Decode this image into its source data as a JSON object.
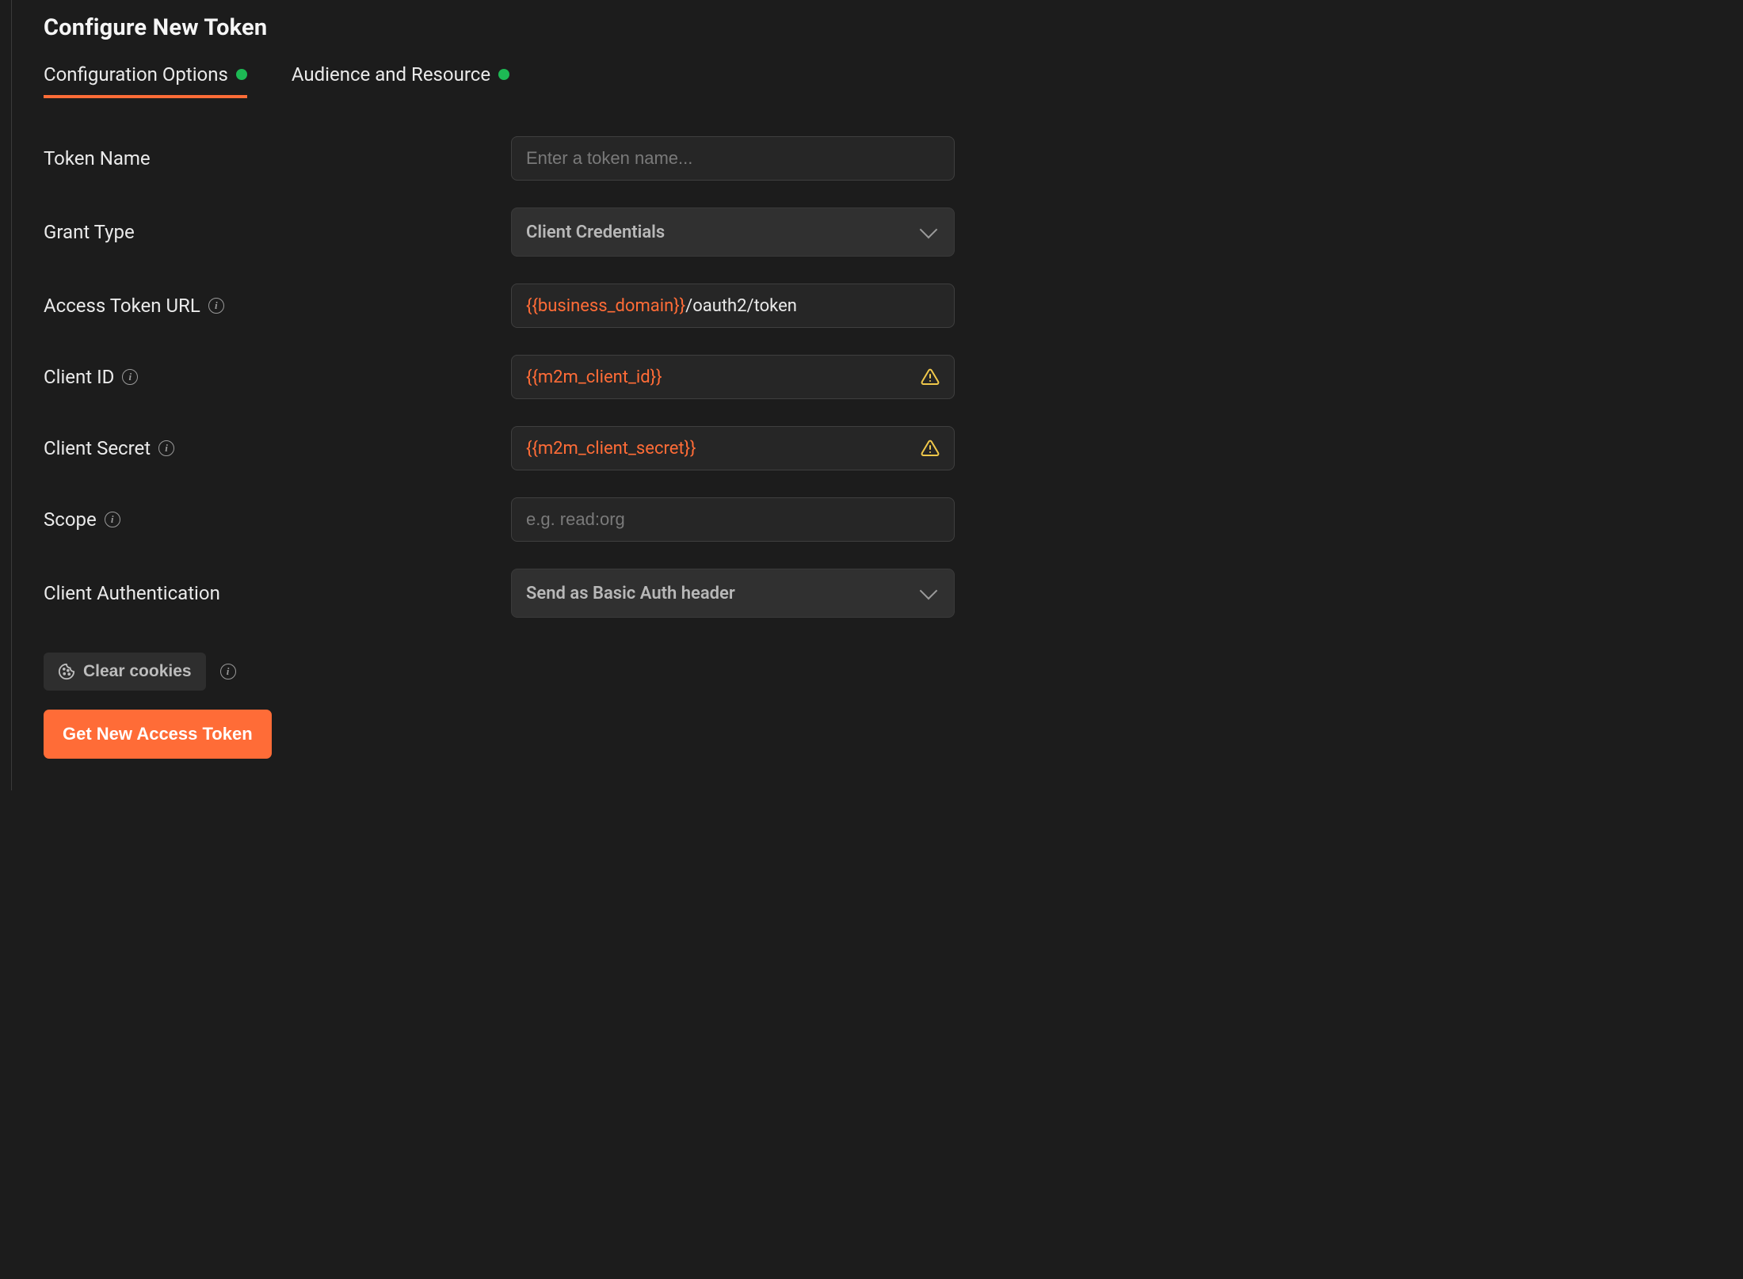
{
  "header": {
    "title": "Configure New Token"
  },
  "tabs": [
    {
      "label": "Configuration Options",
      "active": true
    },
    {
      "label": "Audience and Resource",
      "active": false
    }
  ],
  "fields": {
    "token_name": {
      "label": "Token Name",
      "placeholder": "Enter a token name...",
      "value": ""
    },
    "grant_type": {
      "label": "Grant Type",
      "value": "Client Credentials"
    },
    "access_token_url": {
      "label": "Access Token URL",
      "variable": "{{business_domain}}",
      "suffix": "/oauth2/token"
    },
    "client_id": {
      "label": "Client ID",
      "variable": "{{m2m_client_id}}"
    },
    "client_secret": {
      "label": "Client Secret",
      "variable": "{{m2m_client_secret}}"
    },
    "scope": {
      "label": "Scope",
      "placeholder": "e.g. read:org",
      "value": ""
    },
    "client_auth": {
      "label": "Client Authentication",
      "value": "Send as Basic Auth header"
    }
  },
  "actions": {
    "clear_cookies": "Clear cookies",
    "get_token": "Get New Access Token"
  },
  "colors": {
    "accent": "#ff6c37",
    "success": "#1db954",
    "warning": "#f0c84a"
  }
}
